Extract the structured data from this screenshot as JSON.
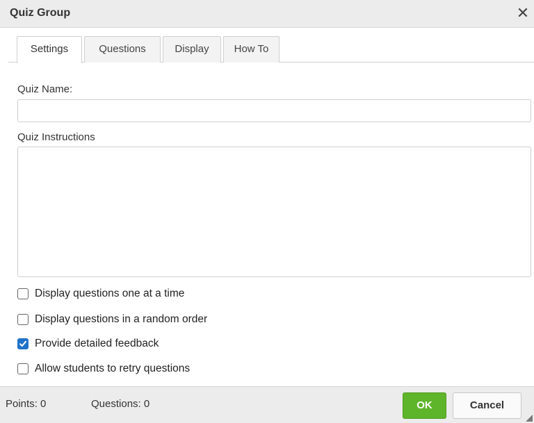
{
  "dialog": {
    "title": "Quiz Group",
    "close_icon": "close-icon"
  },
  "tabs": [
    {
      "label": "Settings",
      "active": true
    },
    {
      "label": "Questions",
      "active": false
    },
    {
      "label": "Display",
      "active": false
    },
    {
      "label": "How To",
      "active": false
    }
  ],
  "settings": {
    "quiz_name_label": "Quiz Name:",
    "quiz_name_value": "",
    "instructions_label": "Quiz Instructions",
    "instructions_value": "",
    "options": [
      {
        "label": "Display questions one at a time",
        "checked": false
      },
      {
        "label": "Display questions in a random order",
        "checked": false
      },
      {
        "label": "Provide detailed feedback",
        "checked": true
      },
      {
        "label": "Allow students to retry questions",
        "checked": false
      }
    ]
  },
  "footer": {
    "points_label": "Points: 0",
    "questions_label": "Questions: 0",
    "ok_label": "OK",
    "cancel_label": "Cancel"
  },
  "colors": {
    "accent_checkbox": "#1f72c9",
    "ok_button": "#5fb52a"
  }
}
